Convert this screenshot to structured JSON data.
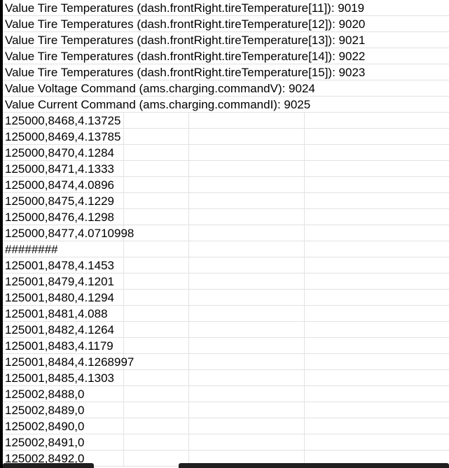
{
  "rows": [
    "Value Tire Temperatures (dash.frontRight.tireTemperature[11]): 9019",
    "Value Tire Temperatures (dash.frontRight.tireTemperature[12]): 9020",
    "Value Tire Temperatures (dash.frontRight.tireTemperature[13]): 9021",
    "Value Tire Temperatures (dash.frontRight.tireTemperature[14]): 9022",
    "Value Tire Temperatures (dash.frontRight.tireTemperature[15]): 9023",
    "Value Voltage Command (ams.charging.commandV): 9024",
    "Value Current Command (ams.charging.commandI): 9025",
    "125000,8468,4.13725",
    "125000,8469,4.13785",
    "125000,8470,4.1284",
    "125000,8471,4.1333",
    "125000,8474,4.0896",
    "125000,8475,4.1229",
    "125000,8476,4.1298",
    "125000,8477,4.0710998",
    "########",
    "125001,8478,4.1453",
    "125001,8479,4.1201",
    "125001,8480,4.1294",
    "125001,8481,4.088",
    "125001,8482,4.1264",
    "125001,8483,4.1179",
    "125001,8484,4.1268997",
    "125001,8485,4.1303",
    "125002,8488,0",
    "125002,8489,0",
    "125002,8490,0",
    "125002,8491,0",
    "125002,8492,0"
  ]
}
